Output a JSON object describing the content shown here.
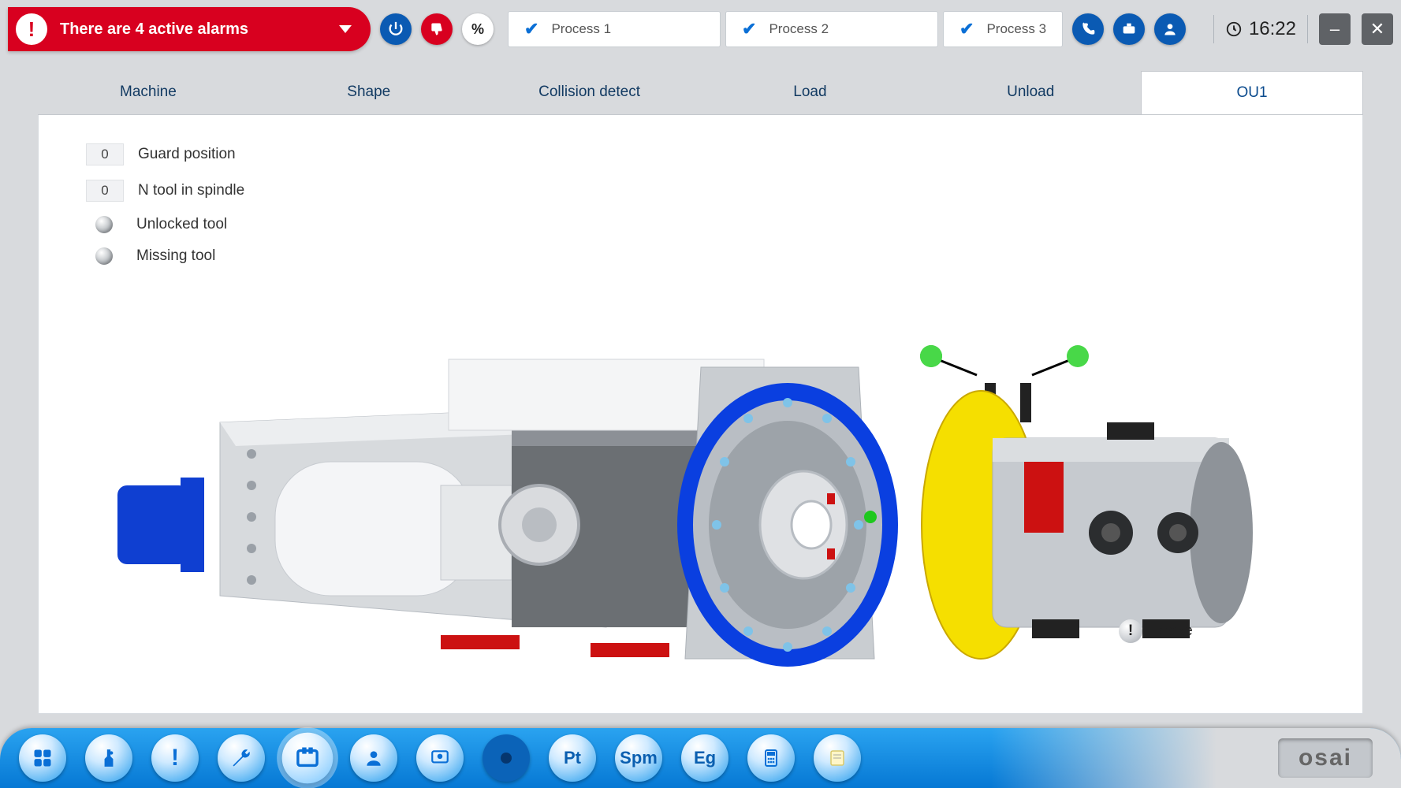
{
  "alarm": {
    "text": "There are 4 active alarms"
  },
  "processes": [
    {
      "label": "Process 1"
    },
    {
      "label": "Process 2"
    },
    {
      "label": "Process 3"
    }
  ],
  "clock": "16:22",
  "subtabs": [
    {
      "label": "Machine"
    },
    {
      "label": "Shape"
    },
    {
      "label": "Collision detect"
    },
    {
      "label": "Load"
    },
    {
      "label": "Unload"
    },
    {
      "label": "OU1"
    }
  ],
  "status": {
    "guard_position": {
      "value": "0",
      "label": "Guard position"
    },
    "tool_in_spindle": {
      "value": "0",
      "label": "N tool in spindle"
    },
    "unlocked_tool": {
      "label": "Unlocked tool"
    },
    "missing_tool": {
      "label": "Missing tool"
    }
  },
  "brake": {
    "label": "Brake"
  },
  "bottom": {
    "pt": "Pt",
    "spm": "Spm",
    "eg": "Eg"
  },
  "logo": "osai"
}
